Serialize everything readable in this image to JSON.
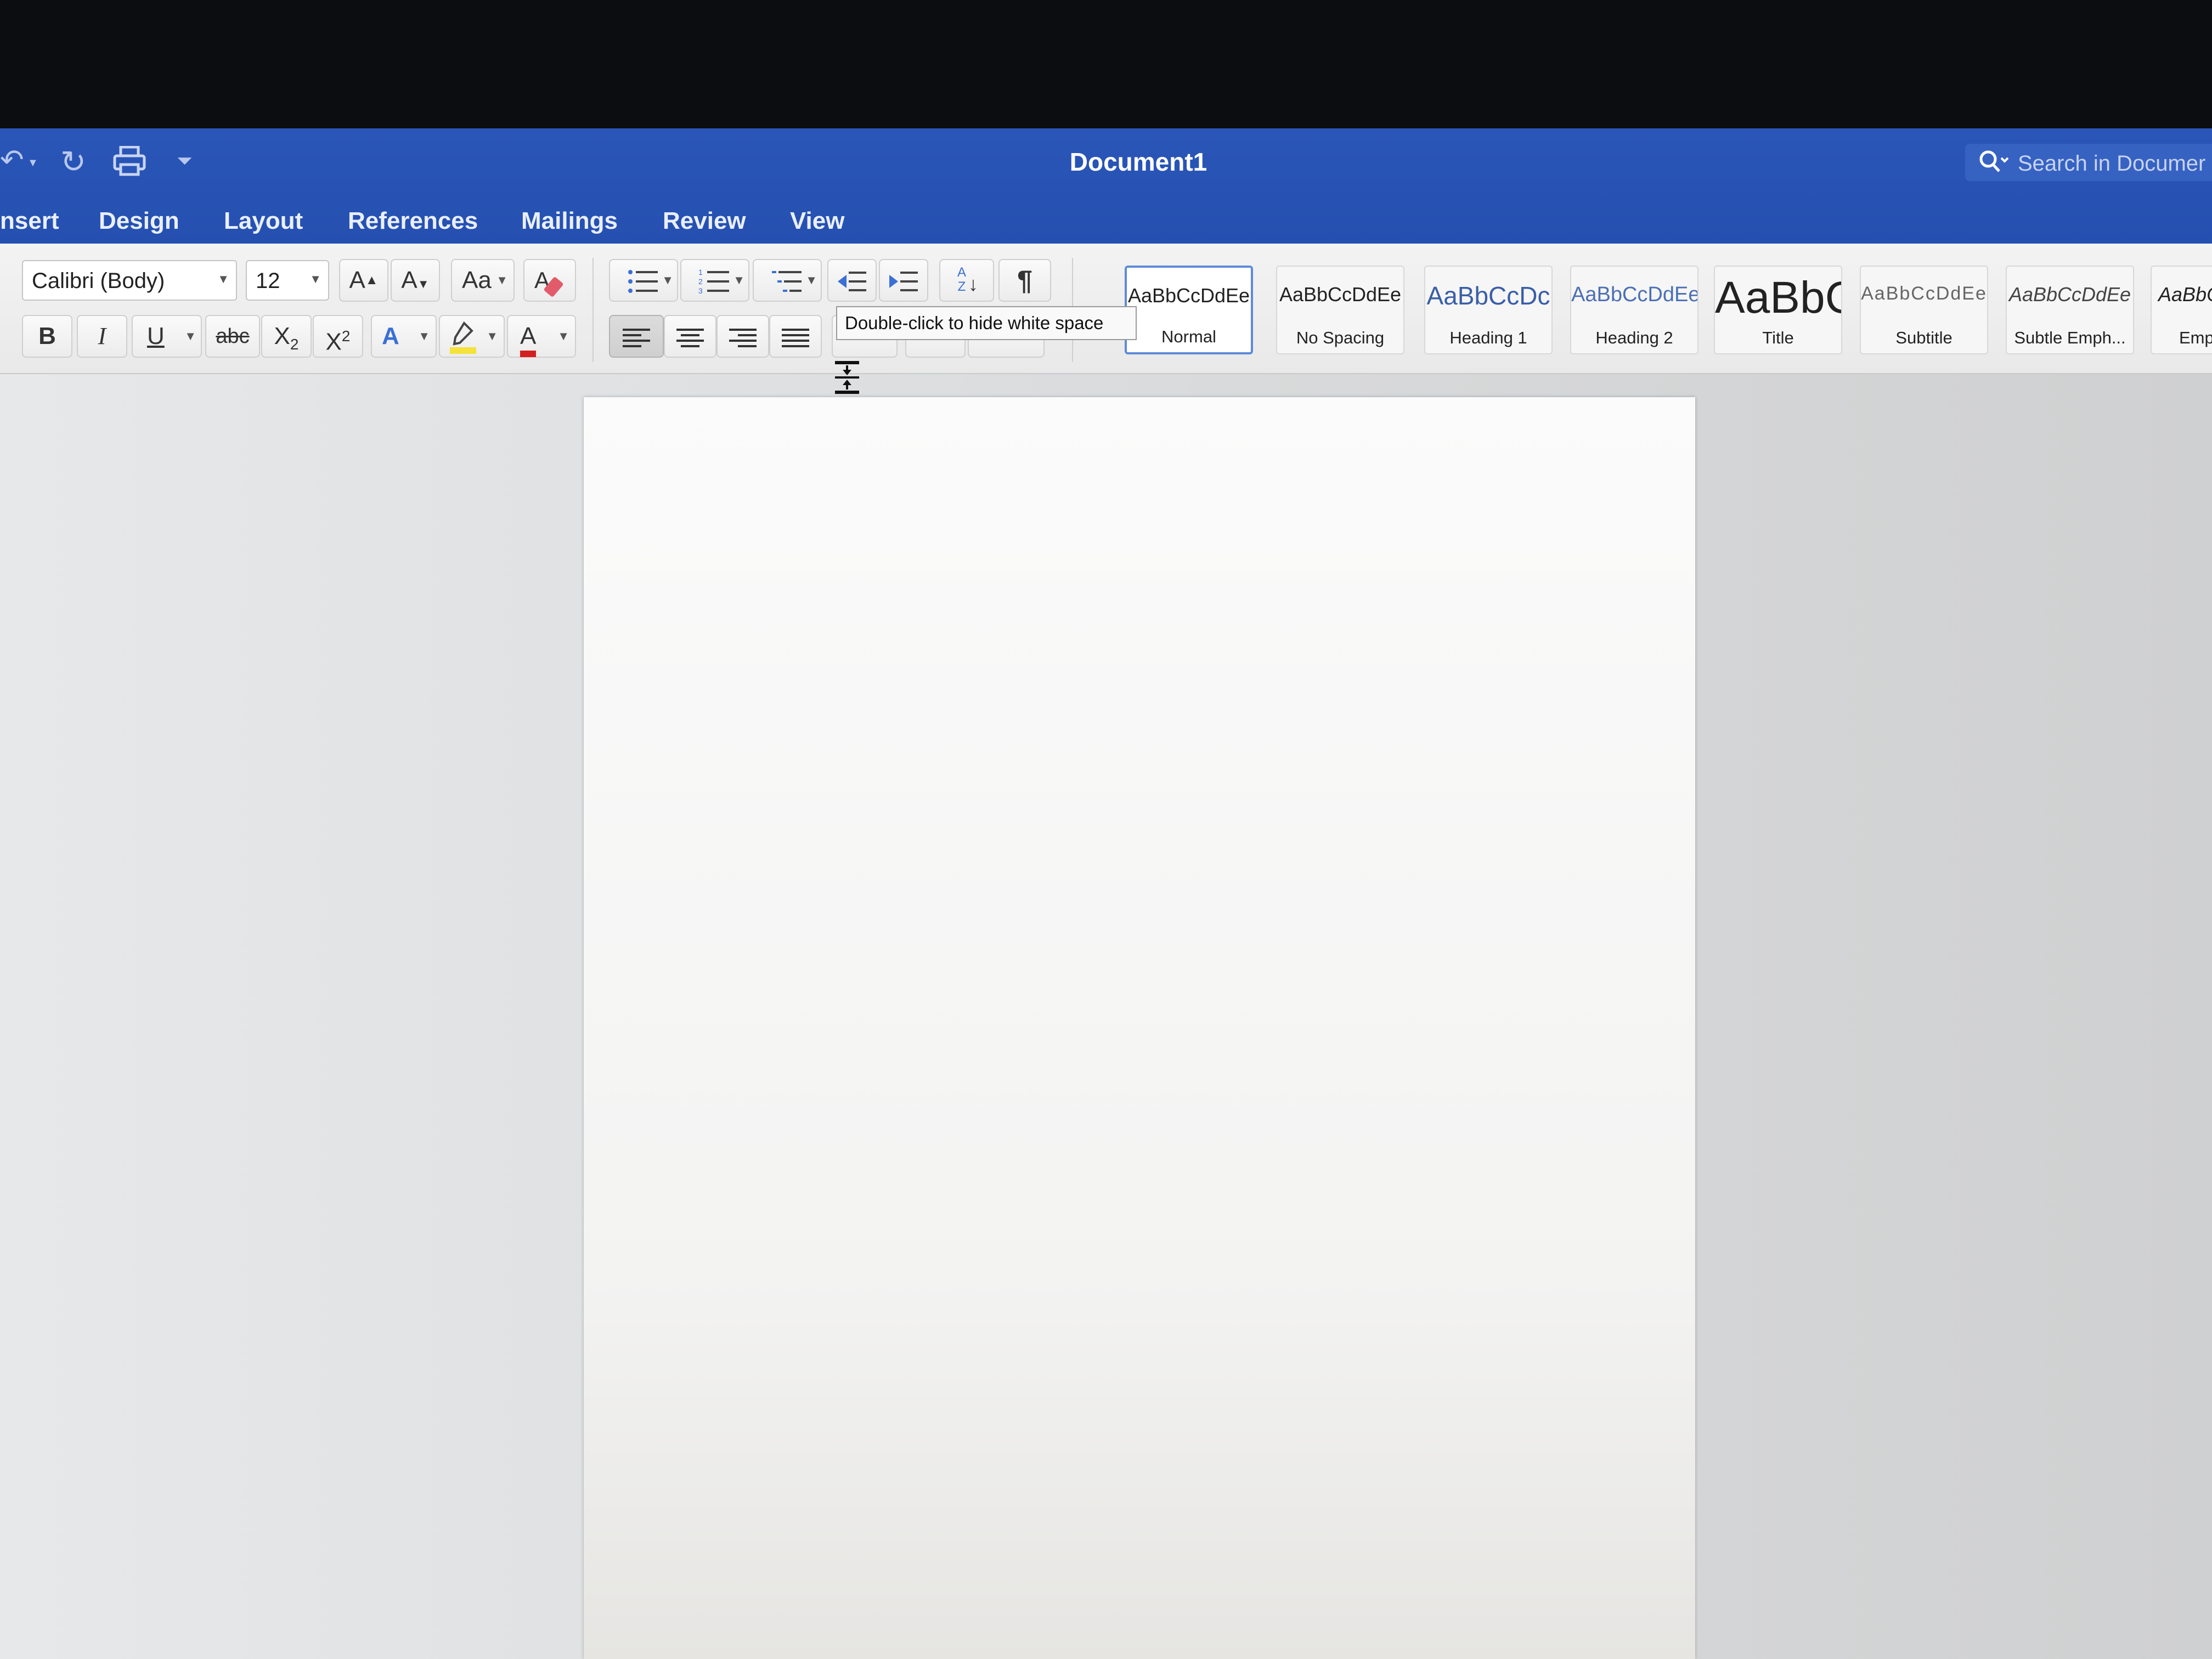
{
  "window": {
    "title": "Document1"
  },
  "quick_access": [
    {
      "icon": "undo-icon",
      "glyph": "↶"
    },
    {
      "icon": "redo-icon",
      "glyph": "↻"
    },
    {
      "icon": "print-icon",
      "glyph": "⎙"
    },
    {
      "icon": "customize-toolbar-icon",
      "glyph": "⏷"
    }
  ],
  "search": {
    "icon": "search-icon",
    "placeholder": "Search in Documer"
  },
  "tabs": [
    "nsert",
    "Design",
    "Layout",
    "References",
    "Mailings",
    "Review",
    "View"
  ],
  "font": {
    "name": "Calibri (Body)",
    "size": "12",
    "grow_label": "A",
    "shrink_label": "A",
    "change_case_label": "Aa",
    "bold": "B",
    "italic": "I",
    "underline": "U",
    "strikethrough": "abc",
    "subscript_base": "X",
    "subscript_mark": "2",
    "superscript_base": "X",
    "superscript_mark": "2",
    "text_effects": "A",
    "font_color": "A",
    "highlight_color": "#f5e23a",
    "font_color_bar": "#d42020"
  },
  "paragraph": {
    "pilcrow": "¶",
    "sort_label": "A Z"
  },
  "styles": [
    {
      "sample": "AaBbCcDdEe",
      "name": "Normal",
      "selected": true
    },
    {
      "sample": "AaBbCcDdEe",
      "name": "No Spacing"
    },
    {
      "sample": "AaBbCcDc",
      "name": "Heading 1"
    },
    {
      "sample": "AaBbCcDdEe",
      "name": "Heading 2"
    },
    {
      "sample": "AaBbC",
      "name": "Title"
    },
    {
      "sample": "AaBbCcDdEe",
      "name": "Subtitle"
    },
    {
      "sample": "AaBbCcDdEe",
      "name": "Subtle Emph..."
    },
    {
      "sample": "AaBbC",
      "name": "Emp"
    }
  ],
  "tooltip": {
    "text": "Double-click to hide white space"
  },
  "colors": {
    "titlebar": "#2a56b8",
    "accent_selected": "#5d8bd8"
  }
}
